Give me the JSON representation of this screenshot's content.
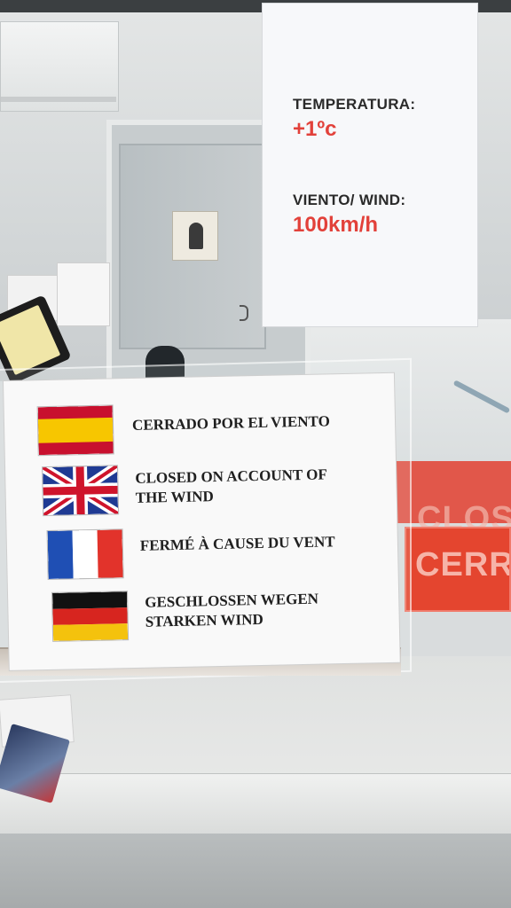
{
  "weather_sign": {
    "temperature_label": "TEMPERATURA:",
    "temperature_value": "+1ºc",
    "wind_label": "VIENTO/ WIND:",
    "wind_value": "100km/h",
    "value_color": "#e2413a"
  },
  "closure_notice": {
    "rows": [
      {
        "flag": "spain-flag",
        "text": "CERRADO POR EL VIENTO"
      },
      {
        "flag": "uk-flag",
        "text": "CLOSED ON ACCOUNT OF\nTHE WIND"
      },
      {
        "flag": "france-flag",
        "text": "FERMÉ À CAUSE DU VENT"
      },
      {
        "flag": "germany-flag",
        "text": "GESCHLOSSEN WEGEN\nSTARKEN WIND"
      }
    ]
  },
  "red_sign": {
    "back_text": "CLOS",
    "front_text": "CERRA",
    "color": "#e4452f"
  }
}
